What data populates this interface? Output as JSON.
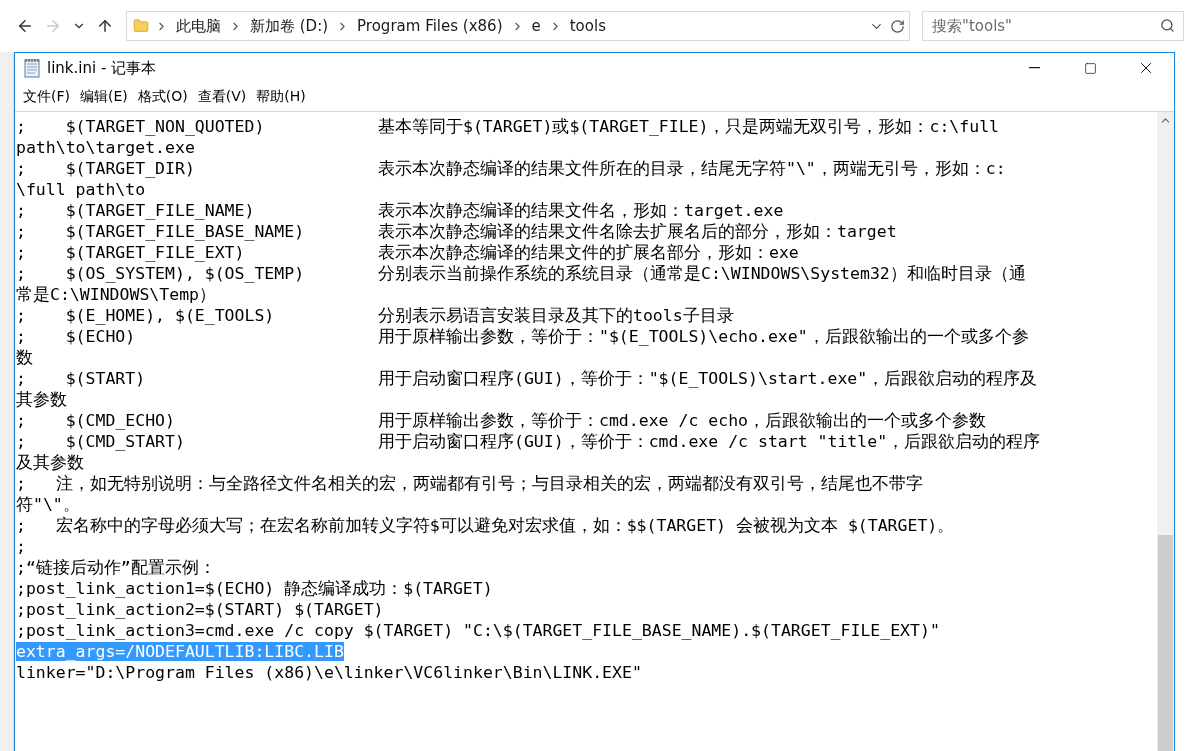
{
  "explorer": {
    "breadcrumb": [
      "此电脑",
      "新加卷 (D:)",
      "Program Files (x86)",
      "e",
      "tools"
    ],
    "search": {
      "placeholder": "搜索\"tools\""
    }
  },
  "window": {
    "title": "link.ini - 记事本"
  },
  "menu": [
    "文件(F)",
    "编辑(E)",
    "格式(O)",
    "查看(V)",
    "帮助(H)"
  ],
  "lines": [
    {
      "kind": "entry",
      "macro": ";    $(TARGET_NON_QUOTED)",
      "text": "基本等同于$(TARGET)或$(TARGET_FILE)，只是两端无双引号，形如：c:\\full",
      "selected": false
    },
    {
      "kind": "plain",
      "text": "path\\to\\target.exe",
      "selected": false
    },
    {
      "kind": "entry",
      "macro": ";    $(TARGET_DIR)",
      "text": "表示本次静态编译的结果文件所在的目录，结尾无字符\"\\\"，两端无引号，形如：c:",
      "selected": false
    },
    {
      "kind": "plain",
      "text": "\\full path\\to",
      "selected": false
    },
    {
      "kind": "entry",
      "macro": ";    $(TARGET_FILE_NAME)",
      "text": "表示本次静态编译的结果文件名，形如：target.exe",
      "selected": false
    },
    {
      "kind": "entry",
      "macro": ";    $(TARGET_FILE_BASE_NAME)",
      "text": "表示本次静态编译的结果文件名除去扩展名后的部分，形如：target",
      "selected": false
    },
    {
      "kind": "entry",
      "macro": ";    $(TARGET_FILE_EXT)",
      "text": "表示本次静态编译的结果文件的扩展名部分，形如：exe",
      "selected": false
    },
    {
      "kind": "entry",
      "macro": ";    $(OS_SYSTEM), $(OS_TEMP)",
      "text": "分别表示当前操作系统的系统目录（通常是C:\\WINDOWS\\System32）和临时目录（通",
      "selected": false
    },
    {
      "kind": "plain",
      "text": "常是C:\\WINDOWS\\Temp）",
      "selected": false
    },
    {
      "kind": "entry",
      "macro": ";    $(E_HOME), $(E_TOOLS)",
      "text": "分别表示易语言安装目录及其下的tools子目录",
      "selected": false
    },
    {
      "kind": "entry",
      "macro": ";    $(ECHO)",
      "text": "用于原样输出参数，等价于：\"$(E_TOOLS)\\echo.exe\"，后跟欲输出的一个或多个参",
      "selected": false
    },
    {
      "kind": "plain",
      "text": "数",
      "selected": false
    },
    {
      "kind": "entry",
      "macro": ";    $(START)",
      "text": "用于启动窗口程序(GUI)，等价于：\"$(E_TOOLS)\\start.exe\"，后跟欲启动的程序及",
      "selected": false
    },
    {
      "kind": "plain",
      "text": "其参数",
      "selected": false
    },
    {
      "kind": "entry",
      "macro": ";    $(CMD_ECHO)",
      "text": "用于原样输出参数，等价于：cmd.exe /c echo，后跟欲输出的一个或多个参数",
      "selected": false
    },
    {
      "kind": "entry",
      "macro": ";    $(CMD_START)",
      "text": "用于启动窗口程序(GUI)，等价于：cmd.exe /c start \"title\"，后跟欲启动的程序",
      "selected": false
    },
    {
      "kind": "plain",
      "text": "及其参数",
      "selected": false
    },
    {
      "kind": "plain",
      "text": ";   注，如无特别说明：与全路径文件名相关的宏，两端都有引号；与目录相关的宏，两端都没有双引号，结尾也不带字",
      "selected": false
    },
    {
      "kind": "plain",
      "text": "符\"\\\"。",
      "selected": false
    },
    {
      "kind": "plain",
      "text": ";   宏名称中的字母必须大写；在宏名称前加转义字符$可以避免对宏求值，如：$$(TARGET) 会被视为文本 $(TARGET)。",
      "selected": false
    },
    {
      "kind": "plain",
      "text": ";",
      "selected": false
    },
    {
      "kind": "plain",
      "text": ";“链接后动作”配置示例：",
      "selected": false
    },
    {
      "kind": "plain",
      "text": ";post_link_action1=$(ECHO) 静态编译成功：$(TARGET)",
      "selected": false
    },
    {
      "kind": "plain",
      "text": ";post_link_action2=$(START) $(TARGET)",
      "selected": false
    },
    {
      "kind": "plain",
      "text": ";post_link_action3=cmd.exe /c copy $(TARGET) \"C:\\$(TARGET_FILE_BASE_NAME).$(TARGET_FILE_EXT)\"",
      "selected": false
    },
    {
      "kind": "plain",
      "text": "extra_args=/NODEFAULTLIB:LIBC.LIB",
      "selected": true
    },
    {
      "kind": "plain",
      "text": "linker=\"D:\\Program Files (x86)\\e\\linker\\VC6linker\\Bin\\LINK.EXE\"",
      "selected": false
    }
  ]
}
